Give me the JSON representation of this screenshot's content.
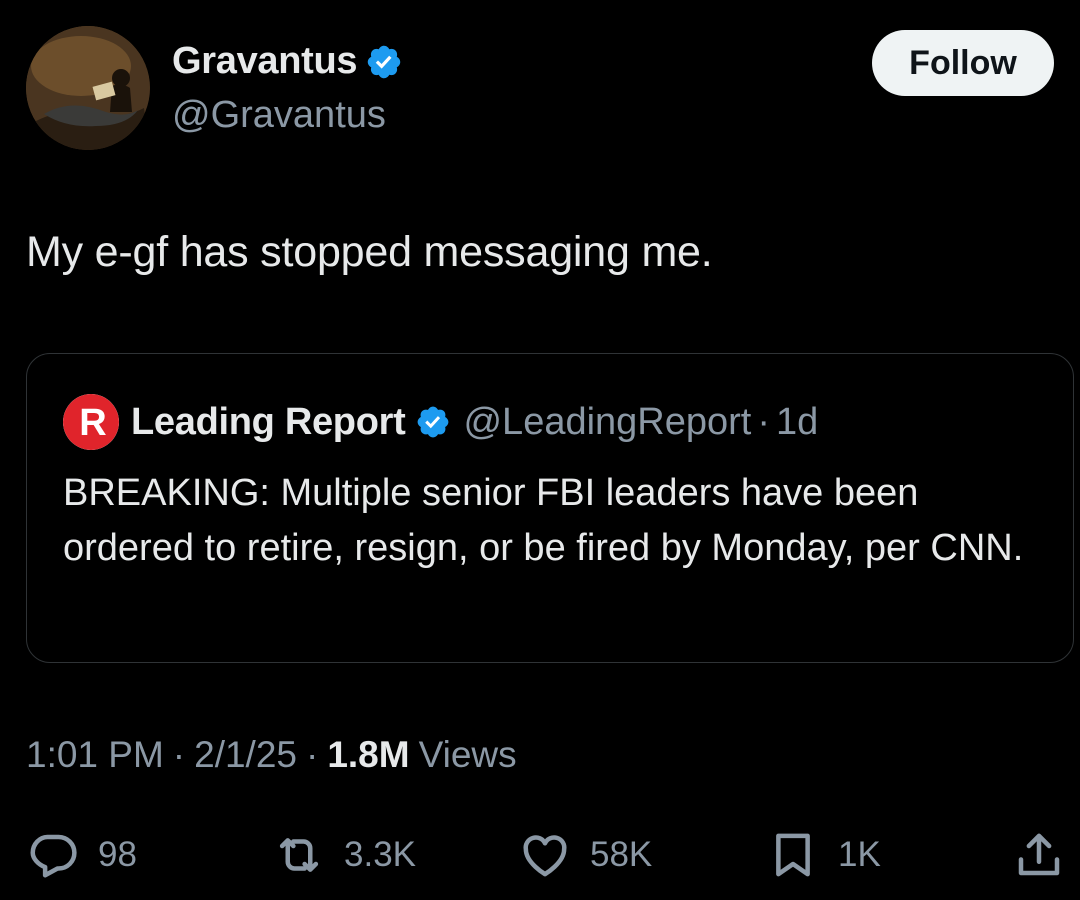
{
  "author": {
    "name": "Gravantus",
    "handle": "@Gravantus",
    "verified_icon": "verified-badge-icon",
    "avatar_icon": "profile-avatar"
  },
  "follow_button": {
    "label": "Follow"
  },
  "tweet": {
    "text": "My e-gf has stopped messaging me."
  },
  "quote": {
    "name": "Leading Report",
    "handle": "@LeadingReport",
    "separator": "·",
    "time": "1d",
    "logo_text": "R",
    "text": "BREAKING: Multiple senior FBI leaders have been ordered to retire, resign, or be fired by Monday, per CNN."
  },
  "meta": {
    "time": "1:01 PM",
    "date": "2/1/25",
    "separator": "·",
    "views_count": "1.8M",
    "views_label": "Views"
  },
  "actions": {
    "replies": "98",
    "reposts": "3.3K",
    "likes": "58K",
    "bookmarks": "1K"
  },
  "colors": {
    "background": "#000000",
    "text_primary": "#e7e9ea",
    "text_secondary": "#8b98a5",
    "verified_blue": "#1d9bf0",
    "border": "#2f3336",
    "follow_bg": "#eff3f4",
    "leading_report_red": "#e0242b"
  }
}
